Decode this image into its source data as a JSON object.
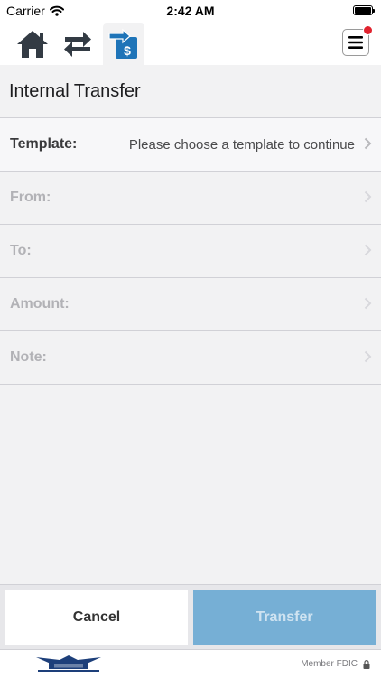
{
  "status_bar": {
    "carrier": "Carrier",
    "time": "2:42 AM"
  },
  "nav": {
    "tabs": [
      {
        "icon": "home-icon"
      },
      {
        "icon": "transfer-arrows-icon"
      },
      {
        "icon": "transfer-money-icon",
        "active": true
      }
    ],
    "menu_icon": "hamburger-menu-icon",
    "has_notification": true
  },
  "page": {
    "title": "Internal Transfer"
  },
  "form": {
    "rows": [
      {
        "label": "Template:",
        "value": "Please choose a template to continue"
      },
      {
        "label": "From:",
        "value": ""
      },
      {
        "label": "To:",
        "value": ""
      },
      {
        "label": "Amount:",
        "value": ""
      },
      {
        "label": "Note:",
        "value": ""
      }
    ]
  },
  "actions": {
    "cancel": "Cancel",
    "transfer": "Transfer"
  },
  "footer": {
    "member": "Member FDIC",
    "lock_icon": "lock-icon"
  },
  "colors": {
    "accent": "#1e74b8",
    "nav_icon": "#333b44",
    "transfer_disabled": "#76afd5",
    "notification": "#e1232f"
  }
}
